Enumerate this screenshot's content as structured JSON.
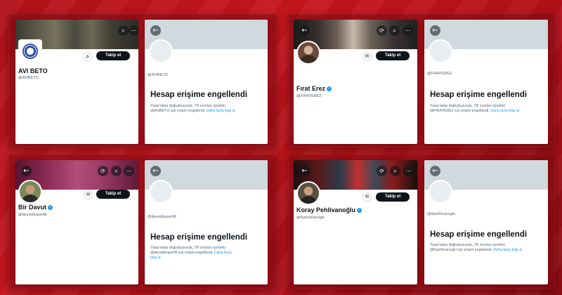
{
  "common": {
    "follow_label": "Takip et",
    "blocked_title": "Hesap erişime engellendi",
    "learn_more": "Daha fazla bilgi al"
  },
  "accounts": [
    {
      "name": "AVI BETO",
      "handle": "@AVIBETO",
      "verified": false,
      "notice_l1": "Yasal talep doğrultusunda, TR sınırları içindeki",
      "notice_l2": "@AVIBETO için erişim engellendi.",
      "learn_more": "Daha fazla bilgi al"
    },
    {
      "name": "Fırat Erez",
      "handle": "@FIRATEREZ",
      "verified": true,
      "notice_l1": "Yasal talep doğrultusunda, TR sınırları içindeki",
      "notice_l2": "@FIRATEREZ için erişim engellendi.",
      "learn_more": "Daha fazla bilgi al"
    },
    {
      "name": "Bir Davut",
      "handle": "@deyvidkoperfilt",
      "verified": true,
      "notice_l1": "Yasal talep doğrultusunda, TR sınırları içindeki",
      "notice_l2": "@deyvidkoperfilt için erişim engellendi.",
      "learn_more_a": "Daha fazla",
      "learn_more_b": "bilgi al"
    },
    {
      "name": "Koray Pehlivanoğlu",
      "handle": "@Kpehlivanoglu",
      "verified": true,
      "notice_l1": "Yasal talep doğrultusunda, TR sınırları içindeki",
      "notice_l2": "@Kpehlivanoglu için erişim engellendi.",
      "learn_more": "Daha fazla bilgi al"
    }
  ],
  "icons": {
    "back": "arrow-left-icon",
    "more": "more-icon",
    "search": "search-icon",
    "message": "message-icon",
    "bell": "notification-icon",
    "verified": "verified-badge-icon"
  },
  "colors": {
    "background": "#c8161f",
    "follow_button": "#0f1419",
    "link": "#1d9bf0",
    "verified": "#1d9bf0"
  }
}
